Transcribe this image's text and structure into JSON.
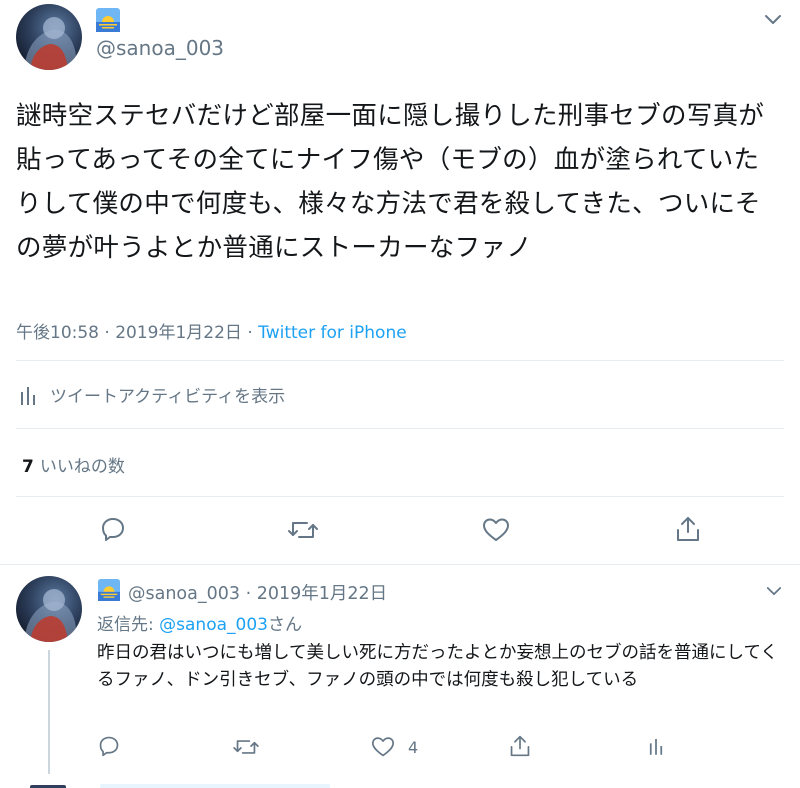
{
  "main_tweet": {
    "handle": "@sanoa_003",
    "text": "謎時空ステセバだけど部屋一面に隠し撮りした刑事セブの写真が貼ってあってその全てにナイフ傷や（モブの）血が塗られていたりして僕の中で何度も、様々な方法で君を殺してきた、ついにその夢が叶うよとか普通にストーカーなファノ",
    "time": "午後10:58 · 2019年1月22日 · ",
    "source": "Twitter for iPhone",
    "activity_label": "ツイートアクティビティを表示",
    "likes_count": "7",
    "likes_label": "いいねの数",
    "actions": [
      "reply-icon",
      "retweet-icon",
      "like-icon",
      "share-icon"
    ]
  },
  "reply_tweet": {
    "handle_date": "@sanoa_003 · 2019年1月22日",
    "reply_to_prefix": "返信先: ",
    "reply_to_mention": "@sanoa_003",
    "reply_to_suffix": "さん",
    "text": "昨日の君はいつにも増して美しい死に方だったよとか妄想上のセブの話を普通にしてくるファノ、ドン引きセブ、ファノの頭の中では何度も殺し犯している",
    "like_count": "4",
    "actions": [
      "reply-icon",
      "retweet-icon",
      "like-icon",
      "share-icon",
      "analytics-icon"
    ]
  },
  "colors": {
    "link": "#1da1f2",
    "secondary_text": "#657786",
    "divider": "#e6ecf0"
  }
}
